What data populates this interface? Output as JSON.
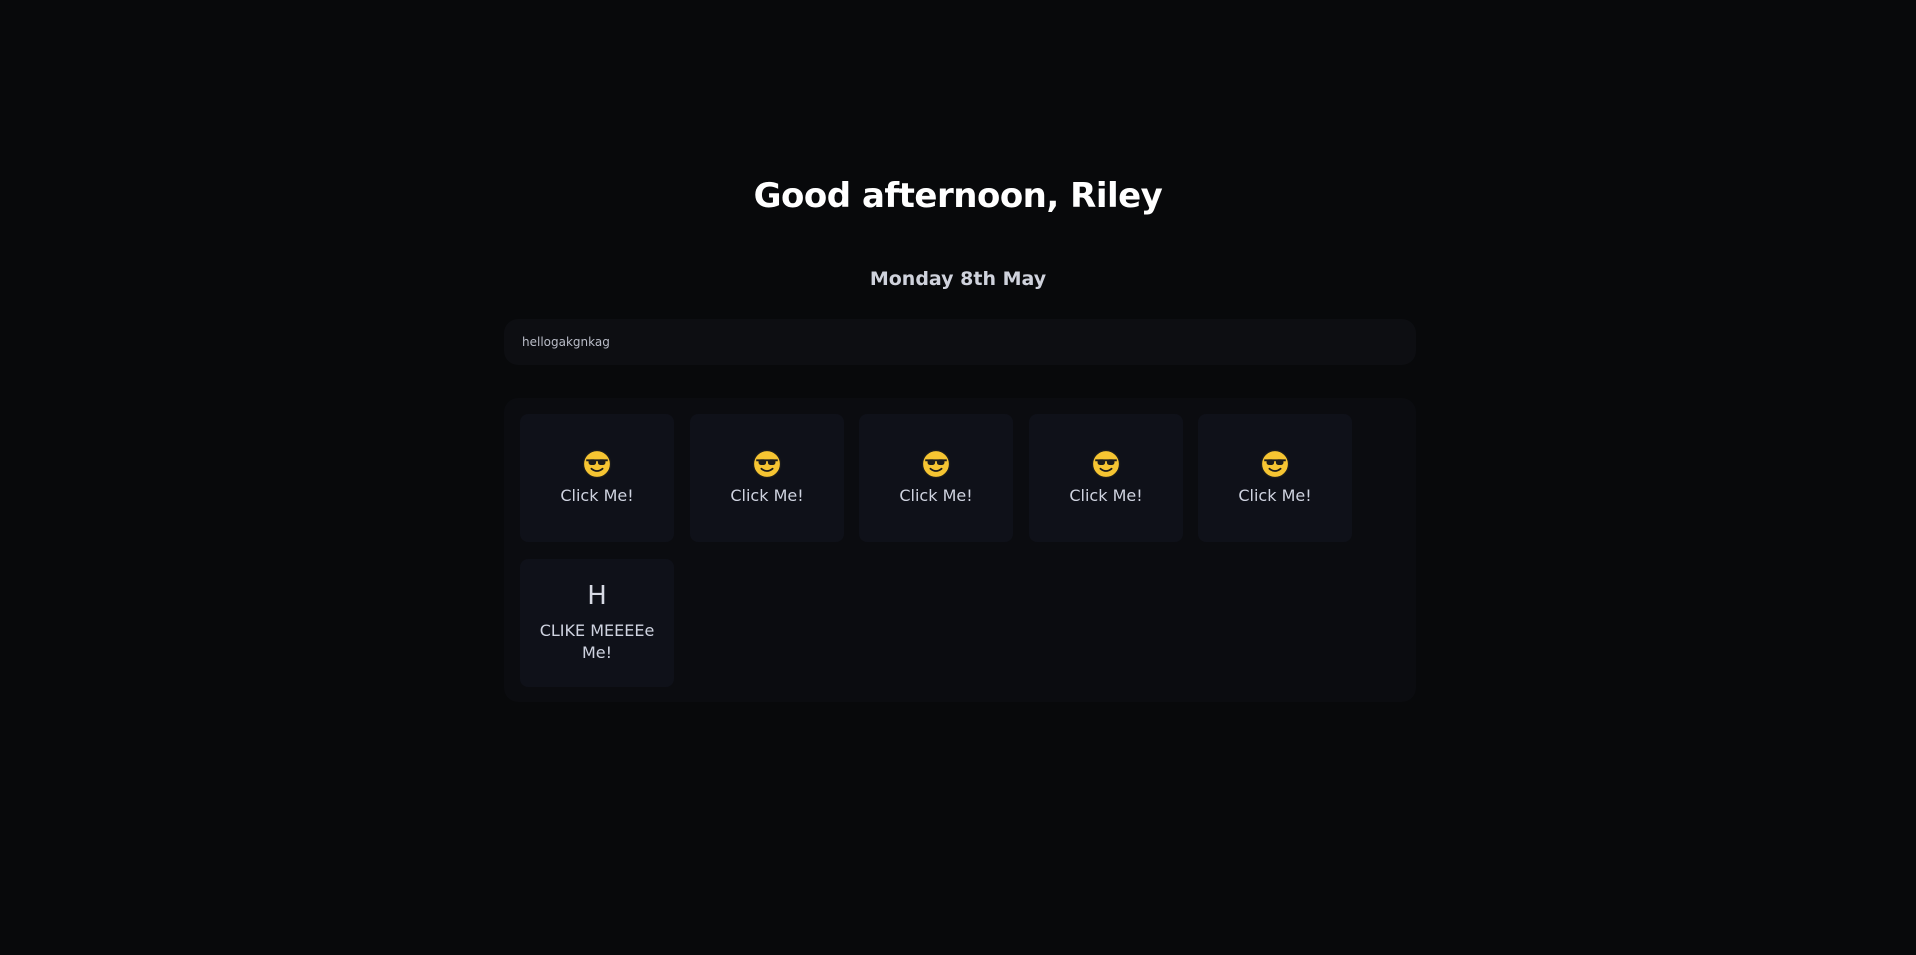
{
  "greeting": "Good afternoon, Riley",
  "date": "Monday 8th May",
  "note": "hellogakgnkag",
  "tiles": [
    {
      "icon": "smiling-face-with-sunglasses-icon",
      "label": "Click Me!"
    },
    {
      "icon": "smiling-face-with-sunglasses-icon",
      "label": "Click Me!"
    },
    {
      "icon": "smiling-face-with-sunglasses-icon",
      "label": "Click Me!"
    },
    {
      "icon": "smiling-face-with-sunglasses-icon",
      "label": "Click Me!"
    },
    {
      "icon": "smiling-face-with-sunglasses-icon",
      "label": "Click Me!"
    },
    {
      "icon_text": "H",
      "label": "CLIKE MEEEEe Me!"
    }
  ],
  "colors": {
    "background": "#08090b",
    "panel": "#0b0c10",
    "tile": "#0f1119",
    "emoji_yellow": "#f6c532"
  }
}
